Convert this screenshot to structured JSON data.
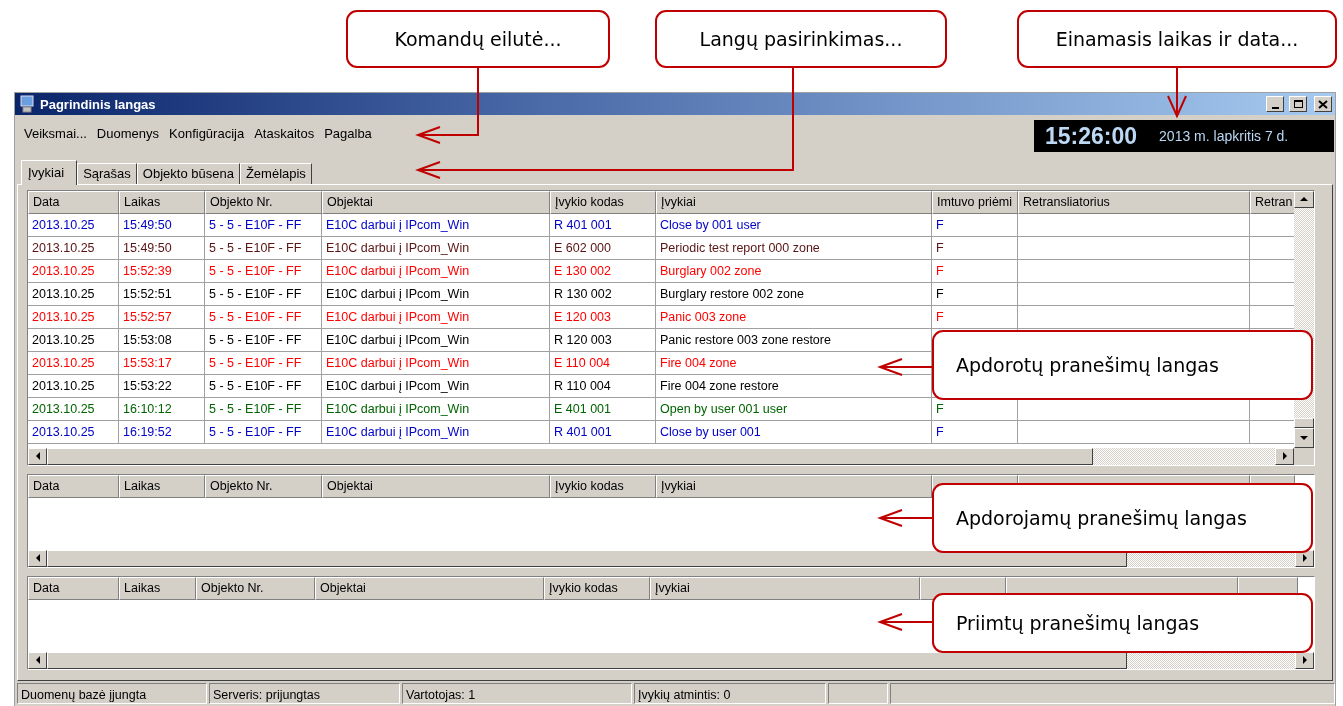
{
  "window": {
    "title": "Pagrindinis langas"
  },
  "menu": [
    "Veiksmai...",
    "Duomenys",
    "Konfigūracija",
    "Ataskaitos",
    "Pagalba"
  ],
  "clock": {
    "time": "15:26:00",
    "date": "2013 m. lapkritis 7 d."
  },
  "tabs": [
    {
      "label": "Įvykiai",
      "selected": true
    },
    {
      "label": "Sąrašas",
      "selected": false
    },
    {
      "label": "Objekto būsena",
      "selected": false
    },
    {
      "label": "Žemėlapis",
      "selected": false
    }
  ],
  "processed_table": {
    "columns": [
      "Data",
      "Laikas",
      "Objekto Nr.",
      "Objektai",
      "Įvykio kodas",
      "Įvykiai",
      "Imtuvo priėmi",
      "Retransliatorius",
      "Retran"
    ],
    "rows": [
      {
        "color": "#0000c8",
        "cells": [
          "2013.10.25",
          "15:49:50",
          "5 - 5 - E10F - FF",
          "E10C darbui į IPcom_Win",
          "R 401 001",
          "Close by 001 user",
          "F"
        ]
      },
      {
        "color": "#5a1414",
        "cells": [
          "2013.10.25",
          "15:49:50",
          "5 - 5 - E10F - FF",
          "E10C darbui į IPcom_Win",
          "E 602 000",
          "Periodic test report 000 zone",
          "F"
        ]
      },
      {
        "color": "#ff0000",
        "cells": [
          "2013.10.25",
          "15:52:39",
          "5 - 5 - E10F - FF",
          "E10C darbui į IPcom_Win",
          "E 130 002",
          "Burglary 002 zone",
          "F"
        ]
      },
      {
        "color": "#000000",
        "cells": [
          "2013.10.25",
          "15:52:51",
          "5 - 5 - E10F - FF",
          "E10C darbui į IPcom_Win",
          "R 130 002",
          "Burglary restore 002 zone",
          "F"
        ]
      },
      {
        "color": "#ff0000",
        "cells": [
          "2013.10.25",
          "15:52:57",
          "5 - 5 - E10F - FF",
          "E10C darbui į IPcom_Win",
          "E 120 003",
          "Panic 003 zone",
          "F"
        ]
      },
      {
        "color": "#000000",
        "cells": [
          "2013.10.25",
          "15:53:08",
          "5 - 5 - E10F - FF",
          "E10C darbui į IPcom_Win",
          "R 120 003",
          "Panic restore 003 zone restore"
        ]
      },
      {
        "color": "#ff0000",
        "cells": [
          "2013.10.25",
          "15:53:17",
          "5 - 5 - E10F - FF",
          "E10C darbui į IPcom_Win",
          "E 110 004",
          "Fire 004 zone"
        ]
      },
      {
        "color": "#000000",
        "cells": [
          "2013.10.25",
          "15:53:22",
          "5 - 5 - E10F - FF",
          "E10C darbui į IPcom_Win",
          "R 110 004",
          "Fire 004 zone restore"
        ]
      },
      {
        "color": "#006400",
        "cells": [
          "2013.10.25",
          "16:10:12",
          "5 - 5 - E10F - FF",
          "E10C darbui į IPcom_Win",
          "E 401 001",
          "Open by user 001 user",
          "F"
        ]
      },
      {
        "color": "#0000c8",
        "cells": [
          "2013.10.25",
          "16:19:52",
          "5 - 5 - E10F - FF",
          "E10C darbui į IPcom_Win",
          "R 401 001",
          "Close by user 001",
          "F"
        ]
      }
    ]
  },
  "processing_table": {
    "columns": [
      "Data",
      "Laikas",
      "Objekto Nr.",
      "Objektai",
      "Įvykio kodas",
      "Įvykiai"
    ]
  },
  "received_table": {
    "columns": [
      "Data",
      "Laikas",
      "Objekto Nr.",
      "Objektai",
      "Įvykio kodas",
      "Įvykiai"
    ]
  },
  "status_bar": [
    "Duomenų bazė įjungta",
    "Serveris: prijungtas",
    "Vartotojas: 1",
    "Įvykių atmintis: 0"
  ],
  "callouts": [
    "Komandų eilutė...",
    "Langų pasirinkimas...",
    "Einamasis laikas ir data...",
    "Apdorotų pranešimų langas",
    "Apdorojamų pranešimų langas",
    "Priimtų pranešimų langas"
  ]
}
